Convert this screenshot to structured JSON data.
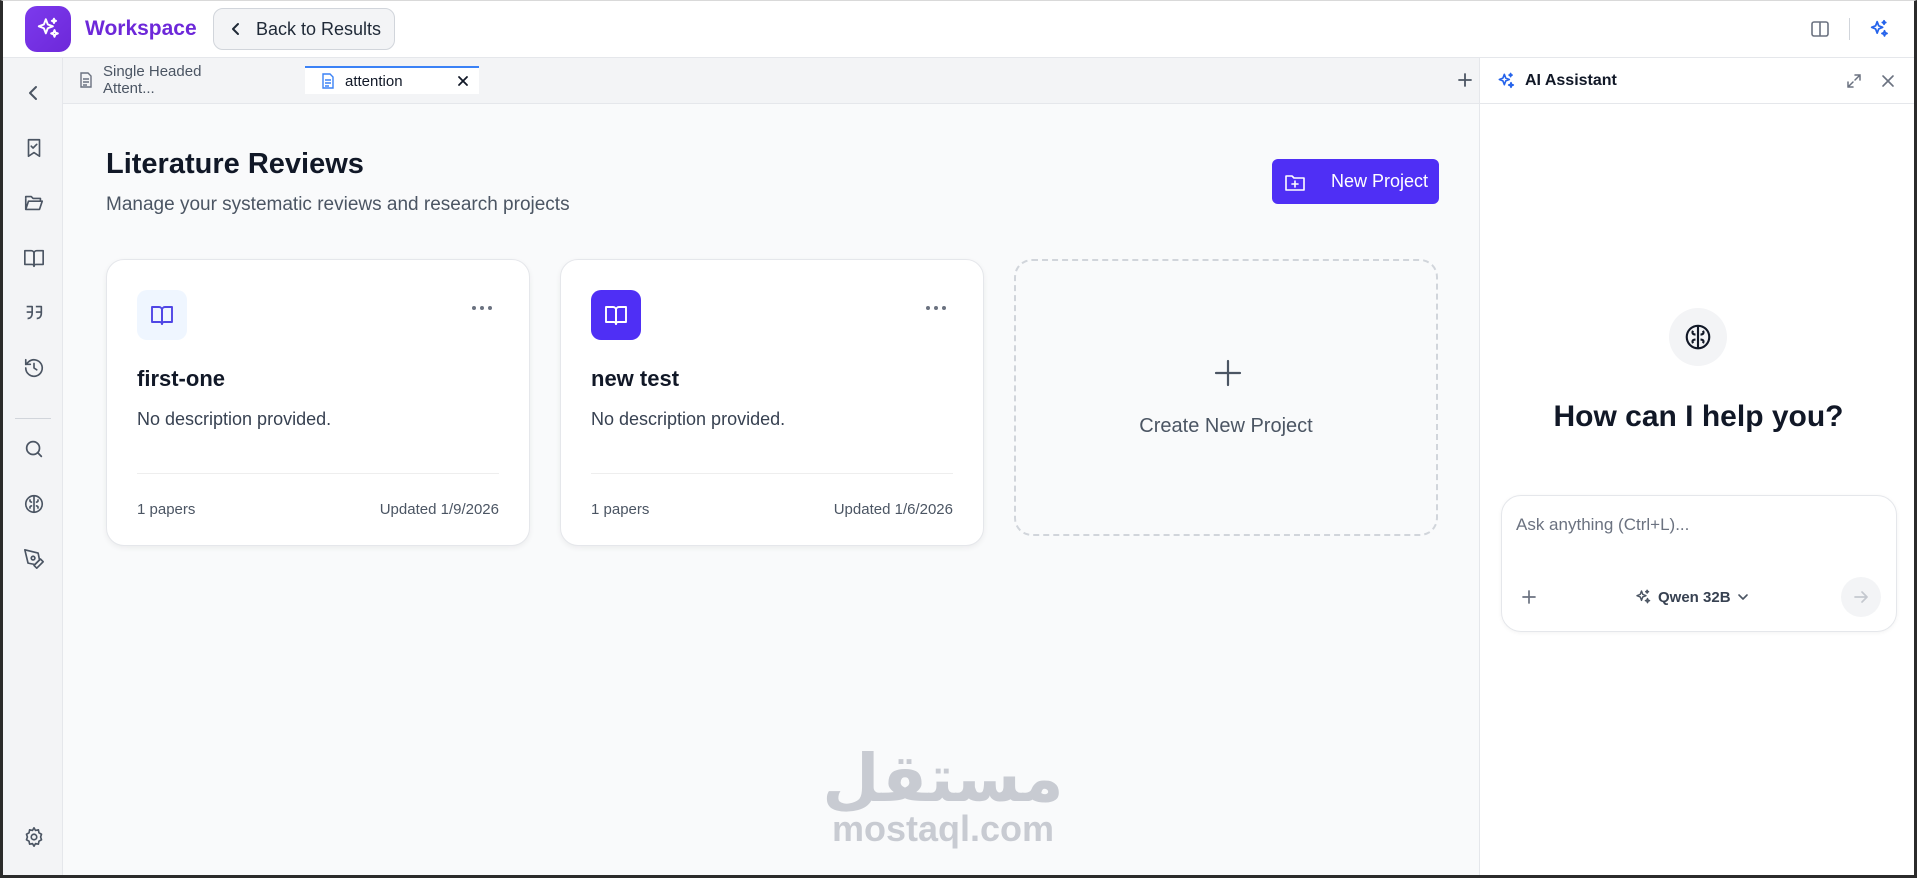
{
  "app": {
    "brand": "Workspace",
    "back_label": "Back to Results"
  },
  "icons": {
    "logo": "sparkles-icon",
    "back": "chevron-left-icon",
    "panel_toggle": "split-panel-icon",
    "assistant_toggle": "sparkles-icon"
  },
  "sidebar": {
    "items": [
      {
        "name": "collapse",
        "icon": "chevron-left-icon"
      },
      {
        "name": "bookmarks",
        "icon": "bookmark-check-icon"
      },
      {
        "name": "folders",
        "icon": "folder-open-icon"
      },
      {
        "name": "library",
        "icon": "book-open-icon"
      },
      {
        "name": "quotes",
        "icon": "quote-icon"
      },
      {
        "name": "history",
        "icon": "history-icon"
      },
      {
        "name": "search",
        "icon": "search-icon"
      },
      {
        "name": "ai-brain",
        "icon": "brain-icon"
      },
      {
        "name": "writing",
        "icon": "pen-tool-icon"
      },
      {
        "name": "settings",
        "icon": "gear-icon"
      }
    ]
  },
  "tabs": [
    {
      "label": "Single Headed Attent...",
      "active": false
    },
    {
      "label": "attention",
      "active": true
    }
  ],
  "main": {
    "title": "Literature Reviews",
    "subtitle": "Manage your systematic reviews and research projects",
    "new_project_label": "New Project",
    "create_label": "Create New Project"
  },
  "projects": [
    {
      "title": "first-one",
      "description": "No description provided.",
      "papers": "1 papers",
      "updated": "Updated 1/9/2026",
      "icon_bg": "#eff6ff",
      "icon_color": "#4f46e5"
    },
    {
      "title": "new test",
      "description": "No description provided.",
      "papers": "1 papers",
      "updated": "Updated 1/6/2026",
      "icon_bg": "#4f2ff5",
      "icon_color": "#ffffff"
    }
  ],
  "assistant": {
    "title": "AI Assistant",
    "greeting": "How can I help you?",
    "placeholder": "Ask anything (Ctrl+L)...",
    "model": "Qwen 32B"
  },
  "watermark": {
    "arabic": "مستقل",
    "latin": "mostaql.com"
  },
  "colors": {
    "brand": "#6d28d9",
    "primary": "#4f2ff5",
    "tab_active": "#3b82f6"
  }
}
